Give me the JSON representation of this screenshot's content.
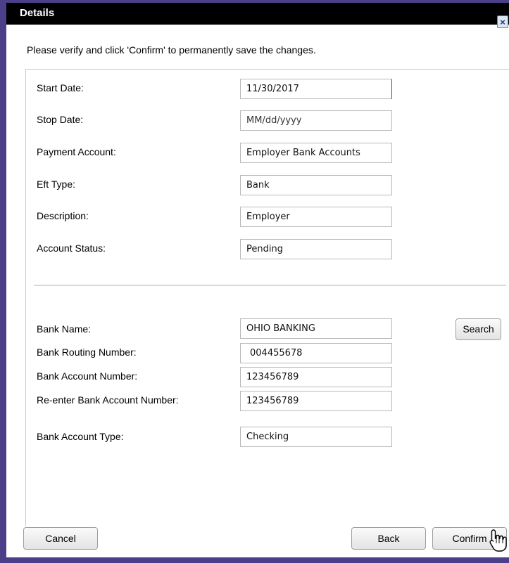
{
  "dialog": {
    "title": "Details"
  },
  "instruction": "Please verify and click 'Confirm' to permanently save the changes.",
  "fields": [
    {
      "label": "Start Date:",
      "value": "11/30/2017"
    },
    {
      "label": "Stop Date:",
      "value": "MM/dd/yyyy"
    },
    {
      "label": "Payment Account:",
      "value": "Employer Bank Accounts"
    },
    {
      "label": "Eft Type:",
      "value": "Bank"
    },
    {
      "label": "Description:",
      "value": "Employer"
    },
    {
      "label": "Account Status:",
      "value": "Pending"
    }
  ],
  "bank_fields": [
    {
      "label": "Bank Name:",
      "value": "OHIO BANKING"
    },
    {
      "label": "Bank Routing Number:",
      "value": "004455678"
    },
    {
      "label": "Bank Account Number:",
      "value": "123456789"
    },
    {
      "label": "Re-enter Bank Account Number:",
      "value": "123456789"
    },
    {
      "label": "Bank Account Type:",
      "value": "Checking"
    }
  ],
  "buttons": {
    "search": "Search",
    "cancel": "Cancel",
    "back": "Back",
    "confirm": "Confirm"
  },
  "colors": {
    "frame": "#4b3f8a",
    "titlebar": "#000000",
    "active_field_border": "#e01a1a"
  },
  "icons": {
    "close": "close-icon",
    "cursor": "hand-pointer-icon"
  }
}
